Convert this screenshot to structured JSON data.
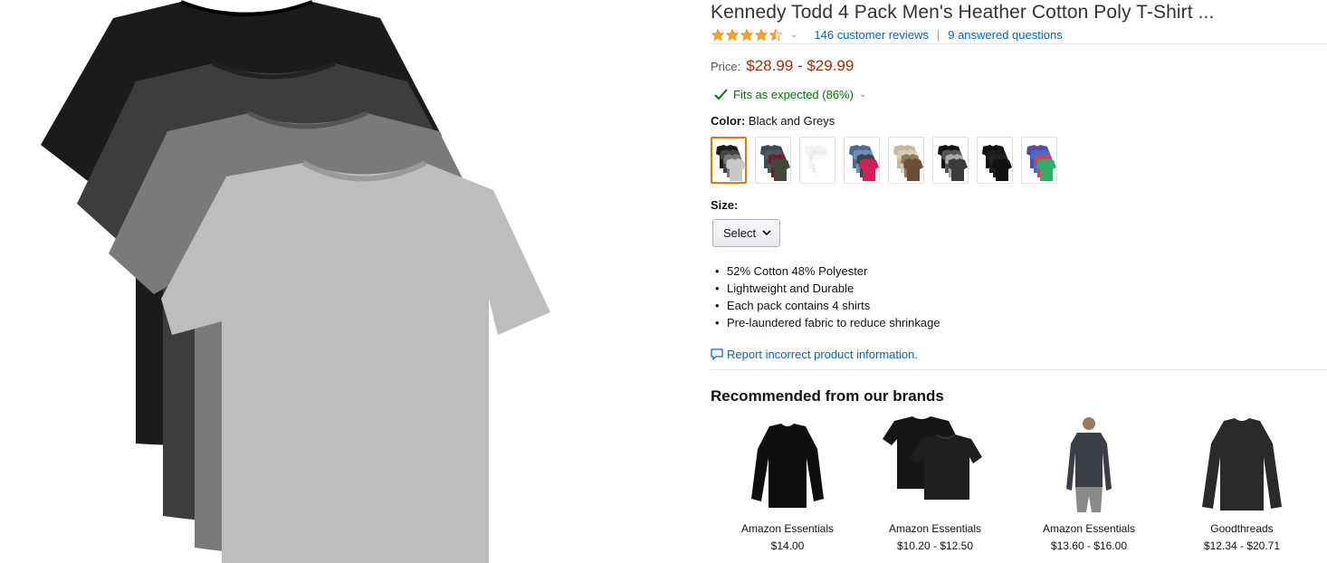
{
  "product": {
    "title": "Kennedy Todd 4 Pack Men's Heather Cotton Poly T-Shirt ...",
    "rating": 4.5,
    "reviews_link": "146 customer reviews",
    "questions_link": "9 answered questions",
    "separator": "|",
    "price_label": "Price:",
    "price": "$28.99 - $29.99",
    "fit_text": "Fits as expected (86%)",
    "color_label": "Color:",
    "color_value": "Black and Greys",
    "size_label": "Size:",
    "size_select": "Select",
    "bullets": [
      "52% Cotton 48% Polyester",
      "Lightweight and Durable",
      "Each pack contains 4 shirts",
      "Pre-laundered fabric to reduce shrinkage"
    ],
    "report_link": "Report incorrect product information."
  },
  "swatches": [
    {
      "colors": [
        "#1a1a1a",
        "#444",
        "#777",
        "#c8c8c8"
      ]
    },
    {
      "colors": [
        "#3d4a5c",
        "#555",
        "#6e1f2e",
        "#3f4a3c"
      ]
    },
    {
      "colors": [
        "#f4f4f4",
        "#ececec",
        "#fafafa",
        "#ffffff"
      ]
    },
    {
      "colors": [
        "#4a6b9a",
        "#6b8fb8",
        "#444",
        "#d21f55"
      ]
    },
    {
      "colors": [
        "#c9b79c",
        "#d9ccb4",
        "#8e7a60",
        "#6b4e33"
      ]
    },
    {
      "colors": [
        "#111",
        "#555",
        "#aaa",
        "#3b3b3b"
      ]
    },
    {
      "colors": [
        "#0f0f0f",
        "#1c1c1c",
        "#222",
        "#111"
      ]
    },
    {
      "colors": [
        "#5a4aa8",
        "#3c6fcf",
        "#d33f5a",
        "#2fae6a"
      ]
    }
  ],
  "recommended": {
    "title": "Recommended from our brands",
    "items": [
      {
        "brand": "Amazon Essentials",
        "price": "$14.00"
      },
      {
        "brand": "Amazon Essentials",
        "price": "$10.20 - $12.50"
      },
      {
        "brand": "Amazon Essentials",
        "price": "$13.60 - $16.00"
      },
      {
        "brand": "Goodthreads",
        "price": "$12.34 - $20.71"
      }
    ]
  },
  "colors": {
    "link": "#0066c0",
    "price": "#b12704",
    "fit": "#007600",
    "selected_border": "#e77600",
    "star": "#ffa41c"
  }
}
